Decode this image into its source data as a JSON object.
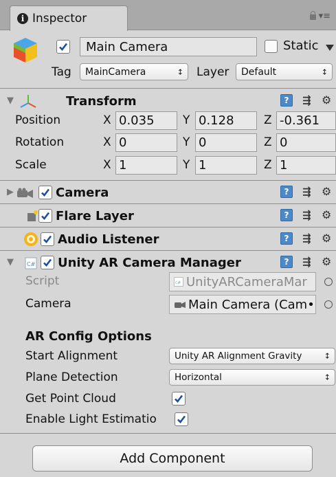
{
  "tab": {
    "title": "Inspector"
  },
  "object": {
    "name": "Main Camera",
    "static_label": "Static",
    "tag_label": "Tag",
    "tag_value": "MainCamera",
    "layer_label": "Layer",
    "layer_value": "Default",
    "active": true,
    "static": false
  },
  "transform": {
    "title": "Transform",
    "rows": [
      {
        "label": "Position",
        "x": "0.035",
        "y": "0.128",
        "z": "-0.361"
      },
      {
        "label": "Rotation",
        "x": "0",
        "y": "0",
        "z": "0"
      },
      {
        "label": "Scale",
        "x": "1",
        "y": "1",
        "z": "1"
      }
    ],
    "axes": {
      "x": "X",
      "y": "Y",
      "z": "Z"
    }
  },
  "components": {
    "camera": "Camera",
    "flare": "Flare Layer",
    "audio": "Audio Listener",
    "ar": "Unity AR Camera Manager"
  },
  "ar_camera_manager": {
    "script_label": "Script",
    "script_value": "UnityARCameraMar",
    "camera_label": "Camera",
    "camera_value": "Main Camera (Cam•",
    "section": "AR Config Options",
    "start_alignment_label": "Start Alignment",
    "start_alignment_value": "Unity AR Alignment Gravity",
    "plane_detection_label": "Plane Detection",
    "plane_detection_value": "Horizontal",
    "point_cloud_label": "Get Point Cloud",
    "light_estimation_label": "Enable Light Estimatio",
    "get_point_cloud": true,
    "enable_light_estimation": true
  },
  "add_component": "Add Component",
  "icons": [
    "info-icon",
    "lock-icon",
    "menu-icon",
    "gameobject-cube-icon",
    "transform-axes-icon",
    "camera-icon",
    "flare-layer-icon",
    "audio-listener-icon",
    "csharp-script-icon",
    "help-icon",
    "preset-icon",
    "gear-icon"
  ],
  "colors": {
    "background": "#d6d6d6",
    "tabbar": "#a9a9a9",
    "help_blue": "#4d88c9"
  }
}
